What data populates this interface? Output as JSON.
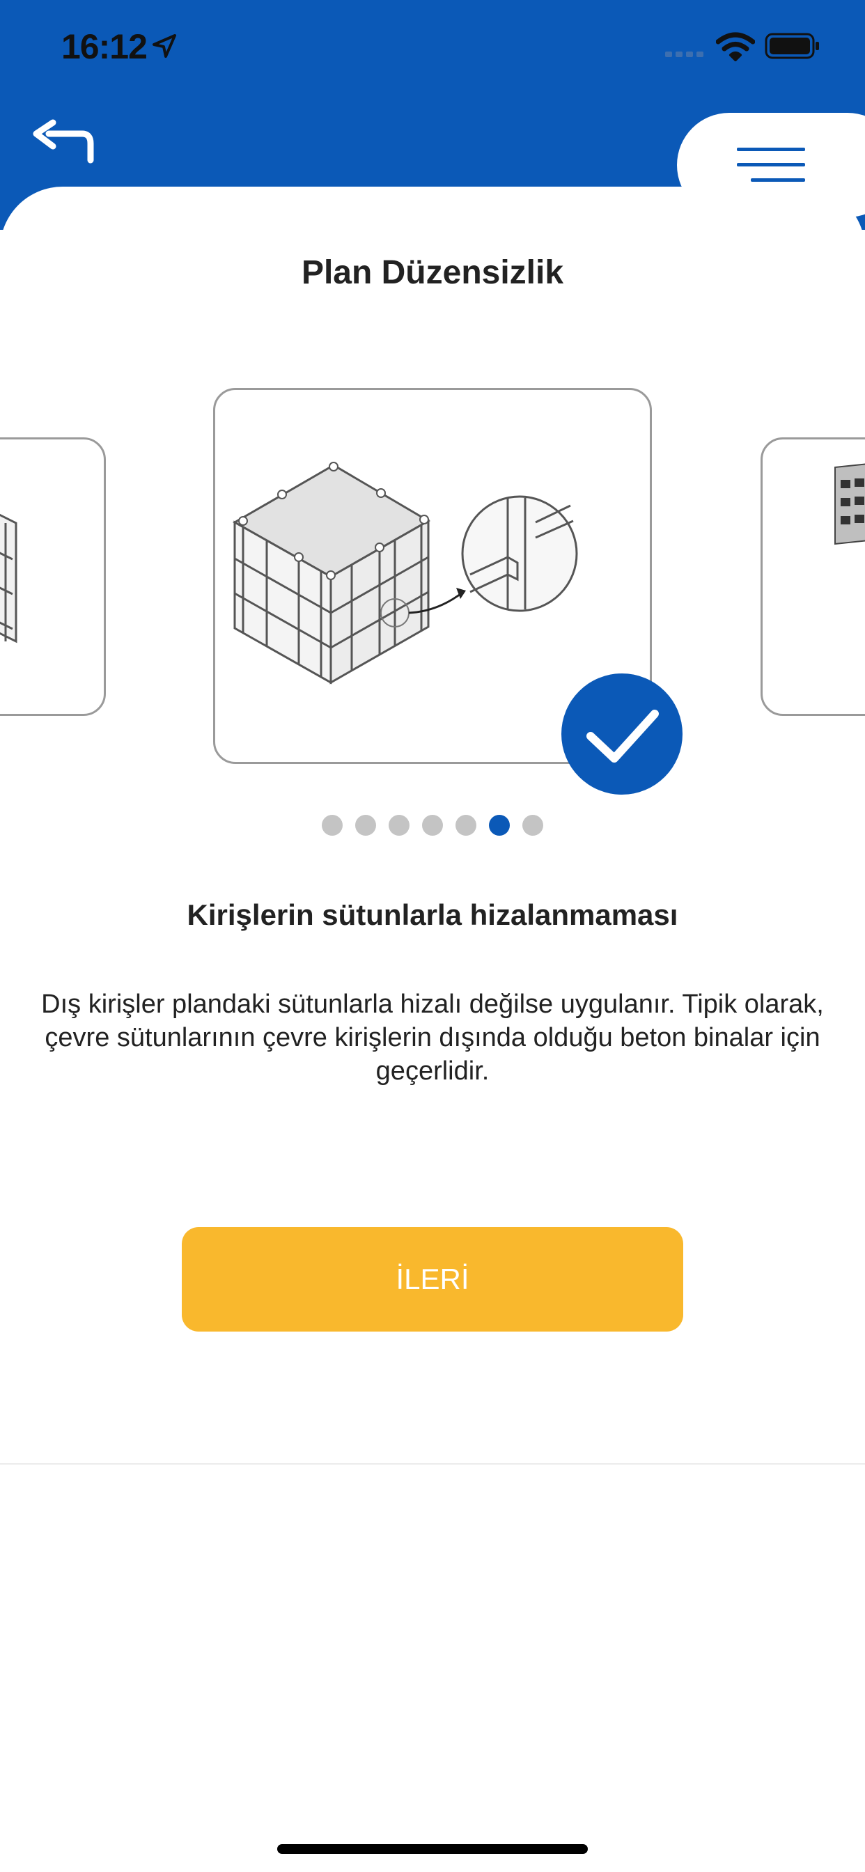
{
  "status_bar": {
    "time": "16:12",
    "icons": [
      "location-arrow-icon",
      "cellular-signal-icon",
      "wifi-icon",
      "battery-icon"
    ]
  },
  "nav": {
    "back_icon": "back-arrow-icon",
    "menu_icon": "hamburger-menu-icon"
  },
  "page": {
    "title": "Plan Düzensizlik"
  },
  "carousel": {
    "selected_icon": "checkmark-icon",
    "dot_count": 7,
    "active_index": 5
  },
  "content": {
    "subtitle": "Kirişlerin sütunlarla hizalanmaması",
    "description": "Dış kirişler plandaki sütunlarla hizalı değilse uygulanır. Tipik olarak, çevre sütunlarının çevre kirişlerin dışında olduğu beton binalar için geçerlidir."
  },
  "actions": {
    "next_label": "İLERİ"
  },
  "colors": {
    "primary": "#0b59b7",
    "accent": "#f9b82d",
    "dot_inactive": "#c4c4c4"
  }
}
